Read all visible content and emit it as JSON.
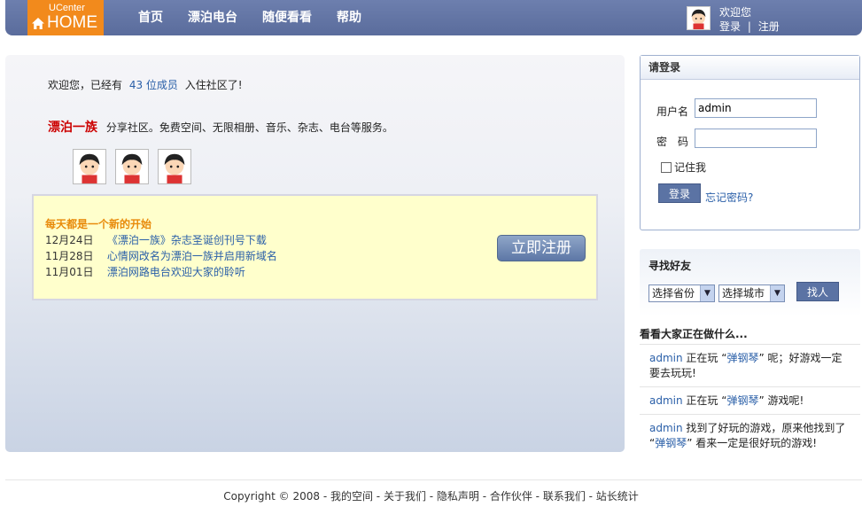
{
  "header": {
    "logo_small": "UCenter",
    "logo_big": "HOME",
    "nav": [
      "首页",
      "漂泊电台",
      "随便看看",
      "帮助"
    ],
    "welcome": "欢迎您",
    "login": "登录",
    "separator": "|",
    "register": "注册"
  },
  "main": {
    "intro_prefix": "欢迎您，已经有",
    "member_count": "43 位成员",
    "intro_suffix": "入住社区了!",
    "brand_name": "漂泊一族",
    "brand_desc": "分享社区。免费空间、无限相册、音乐、杂志、电台等服务。",
    "news_title": "每天都是一个新的开始",
    "news": [
      {
        "date": "12月24日",
        "text": "《漂泊一族》杂志圣诞创刊号下载"
      },
      {
        "date": "11月28日",
        "text": "心情网改名为漂泊一族并启用新域名"
      },
      {
        "date": "11月01日",
        "text": "漂泊网路电台欢迎大家的聆听"
      }
    ],
    "register_button": "立即注册"
  },
  "login_box": {
    "title": "请登录",
    "username_label": "用户名",
    "username_value": "admin",
    "password_label": "密　码",
    "remember_label": "记住我",
    "login_button": "登录",
    "forgot_link": "忘记密码?"
  },
  "find_friends": {
    "title": "寻找好友",
    "province_select": "选择省份",
    "city_select": "选择城市",
    "find_button": "找人"
  },
  "activity": {
    "title": "看看大家正在做什么...",
    "items": [
      {
        "user": "admin",
        "before": " 正在玩 “",
        "game": "弹钢琴",
        "after": "” 呢；好游戏一定要去玩玩!"
      },
      {
        "user": "admin",
        "before": " 正在玩 “",
        "game": "弹钢琴",
        "after": "” 游戏呢!"
      },
      {
        "user": "admin",
        "before": " 找到了好玩的游戏，原来他找到了 “",
        "game": "弹钢琴",
        "after": "” 看来一定是很好玩的游戏!"
      }
    ]
  },
  "footer": {
    "text": "Copyright © 2008 - 我的空间 - 关于我们 - 隐私声明 - 合作伙伴 - 联系我们 - 站长统计"
  }
}
